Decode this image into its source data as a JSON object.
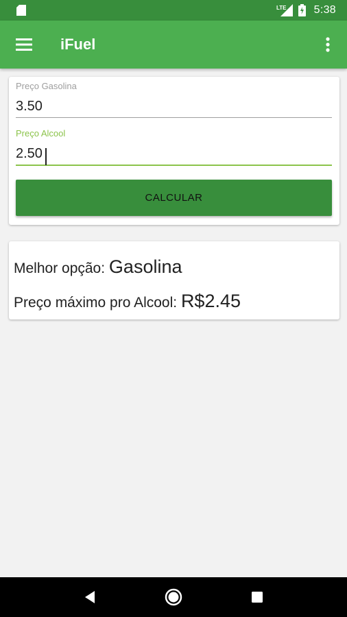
{
  "status_bar": {
    "time": "5:38",
    "icons": [
      "sd-card-icon",
      "lte-signal-icon",
      "battery-charging-icon"
    ]
  },
  "app_bar": {
    "title": "iFuel",
    "icons": [
      "menu-icon",
      "more-vert-icon"
    ]
  },
  "form": {
    "gasoline": {
      "label": "Preço Gasolina",
      "value": "3.50"
    },
    "alcohol": {
      "label": "Preço Alcool",
      "value": "2.50"
    },
    "calculate_label": "CALCULAR"
  },
  "result": {
    "best_option_label": "Melhor opção: ",
    "best_option_value": "Gasolina",
    "max_price_label": "Preço máximo pro Alcool: ",
    "max_price_value": "R$2.45"
  },
  "nav_bar": {
    "icons": [
      "back-icon",
      "home-icon",
      "recents-icon"
    ]
  },
  "colors": {
    "primary": "#4caf50",
    "primary_dark": "#388e3c",
    "accent": "#8bc34a",
    "background": "#f2f2f2"
  }
}
